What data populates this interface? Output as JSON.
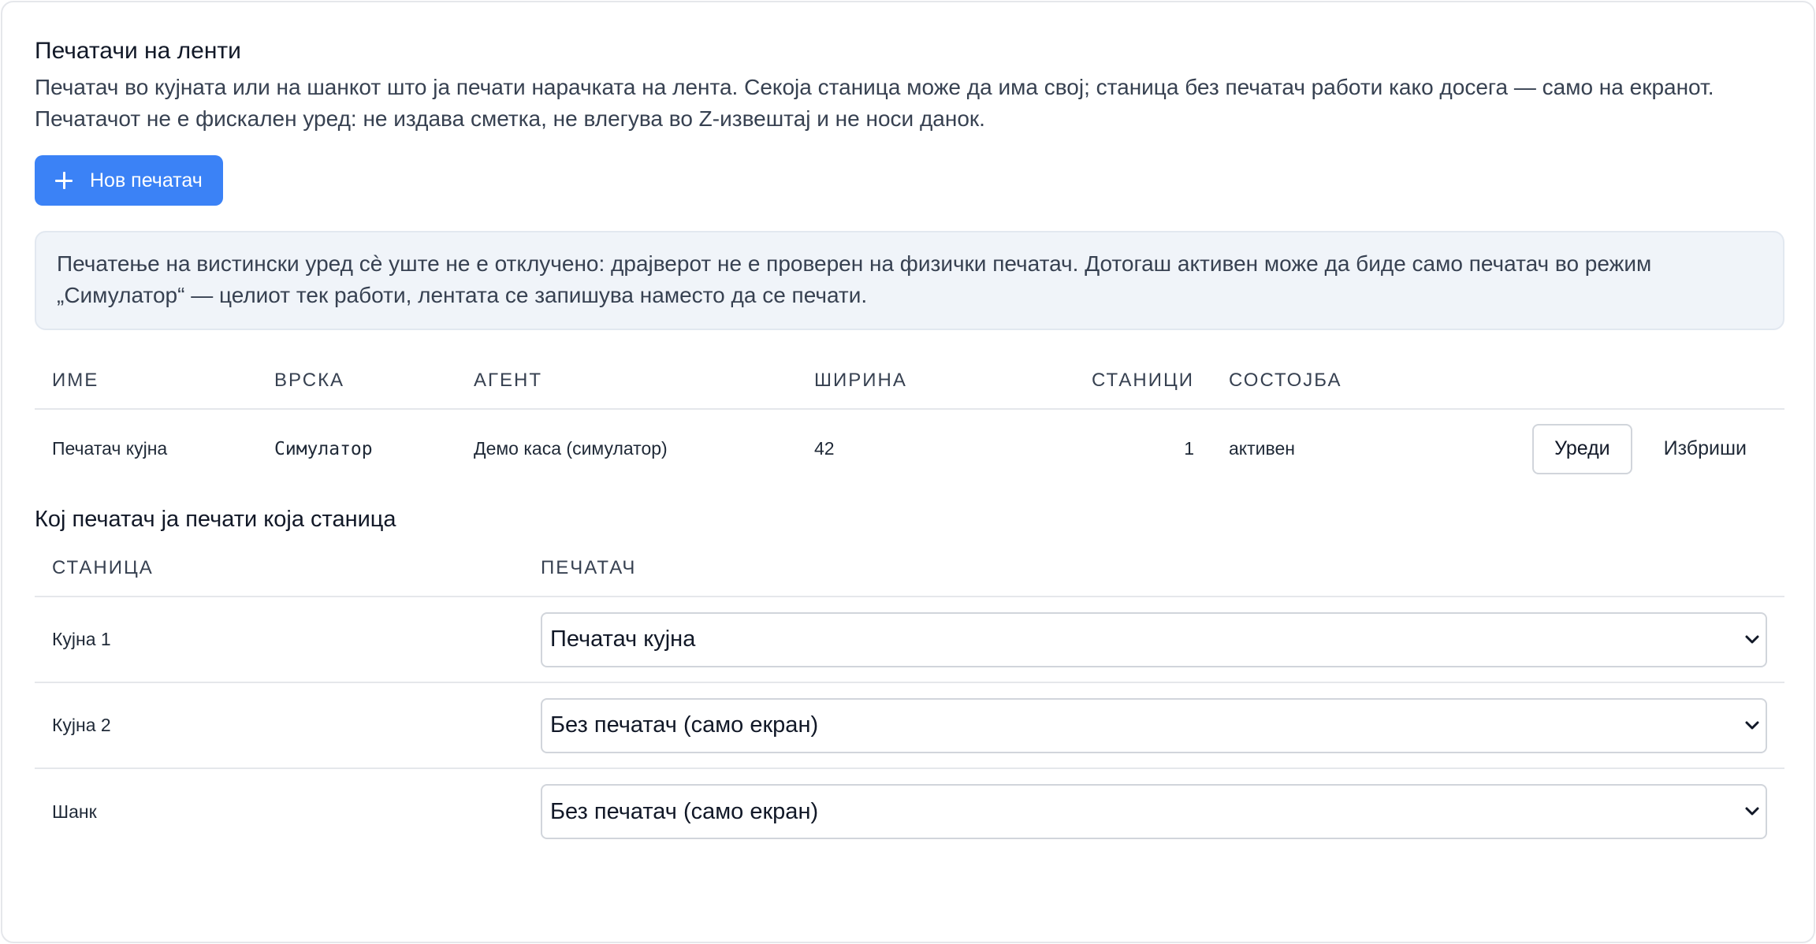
{
  "header": {
    "title": "Печатачи на ленти",
    "desc_line1": "Печатач во кујната или на шанкот што ја печати нарачката на лента. Секоја станица може да има свој; станица без печатач работи како досега — само на екранот.",
    "desc_line2": "Печатачот не е фискален уред: не издава сметка, не влегува во Z-извештај и не носи данок."
  },
  "actions": {
    "new_printer_label": "Нов печатач"
  },
  "notice": "Печатење на вистински уред сè уште не е отклучено: драјверот не е проверен на физички печатач. Дотогаш активен може да биде само печатач во режим „Симулатор“ — целиот тек работи, лентата се запишува наместо да се печати.",
  "printers_table": {
    "headers": {
      "name": "ИМЕ",
      "connection": "ВРСКА",
      "agent": "АГЕНТ",
      "width": "ШИРИНА",
      "stations": "СТАНИЦИ",
      "status": "СОСТОЈБА"
    },
    "rows": [
      {
        "name": "Печатач кујна",
        "connection": "Симулатор",
        "agent": "Демо каса (симулатор)",
        "width": "42",
        "stations": "1",
        "status": "активен",
        "edit_label": "Уреди",
        "delete_label": "Избриши"
      }
    ]
  },
  "mapping": {
    "title": "Кој печатач ја печати која станица",
    "headers": {
      "station": "СТАНИЦА",
      "printer": "ПЕЧАТАЧ"
    },
    "rows": [
      {
        "station": "Кујна 1",
        "printer": "Печатач кујна"
      },
      {
        "station": "Кујна 2",
        "printer": "Без печатач (само екран)"
      },
      {
        "station": "Шанк",
        "printer": "Без печатач (само екран)"
      }
    ]
  },
  "colors": {
    "primary": "#3b82f6",
    "notice_bg": "#f0f4f9",
    "border": "#e5e7eb"
  }
}
